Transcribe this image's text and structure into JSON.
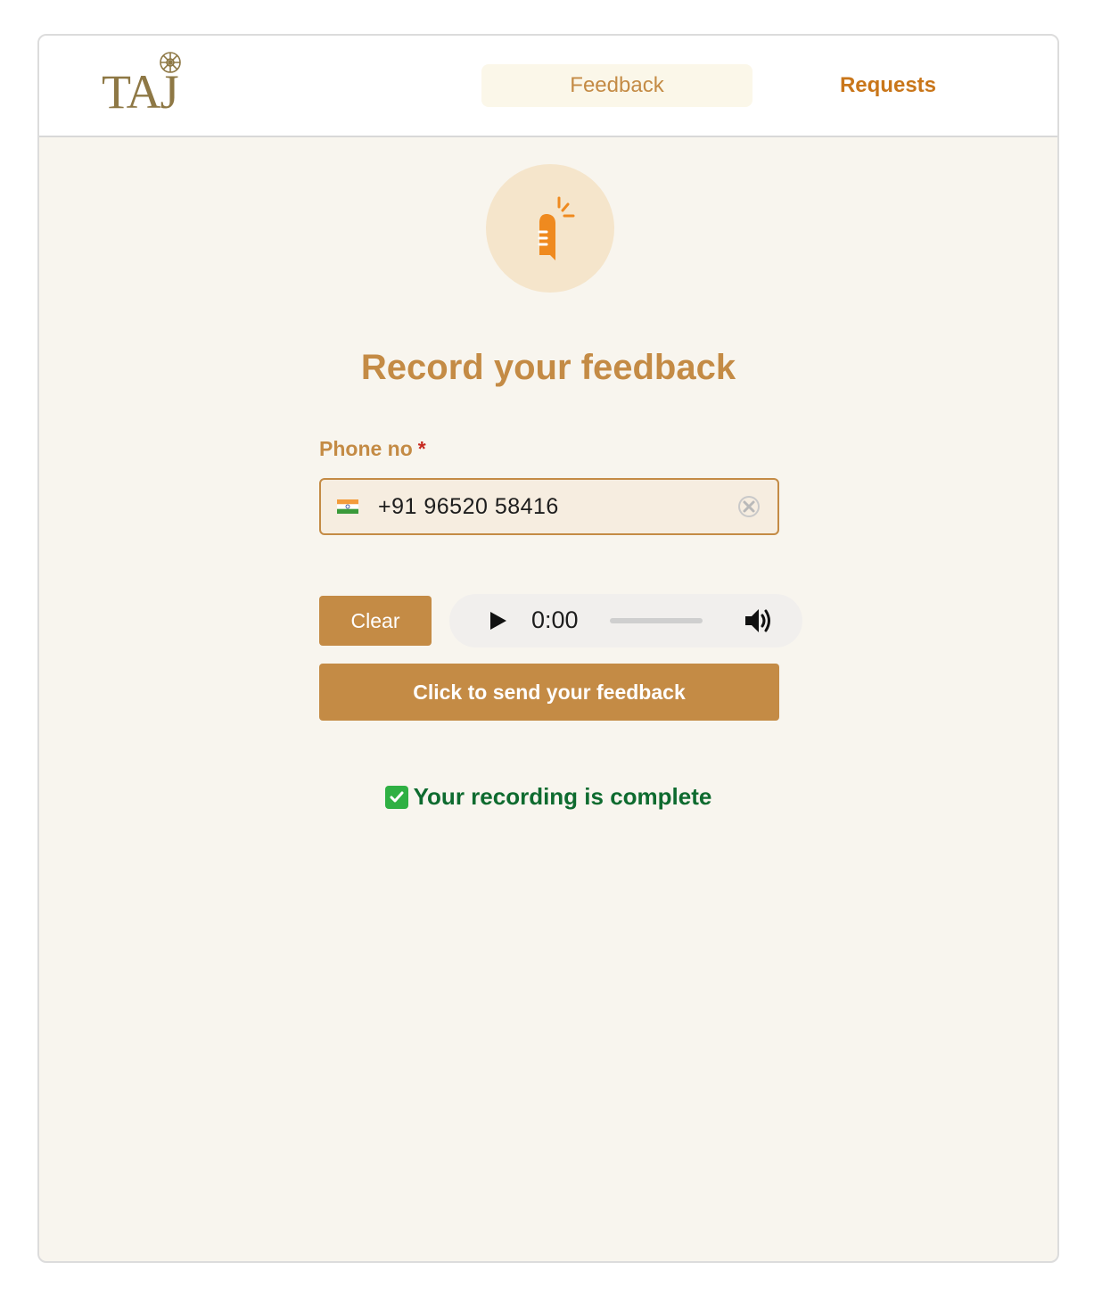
{
  "header": {
    "logo_text": "TAJ",
    "tabs": [
      {
        "label": "Feedback",
        "active": true
      },
      {
        "label": "Requests",
        "active": false
      }
    ]
  },
  "main": {
    "title": "Record your feedback",
    "phone": {
      "label": "Phone no",
      "required_mark": "*",
      "value": "+91 96520 58416",
      "country": "India"
    },
    "clear_label": "Clear",
    "audio": {
      "time": "0:00",
      "progress": 0
    },
    "send_label": "Click to send your feedback",
    "status": {
      "text": "Your recording is complete"
    }
  },
  "colors": {
    "accent": "#c48b45",
    "tab_text": "#c9761a",
    "background": "#f8f5ee",
    "success": "#0e6b2f",
    "required": "#c6281f"
  }
}
